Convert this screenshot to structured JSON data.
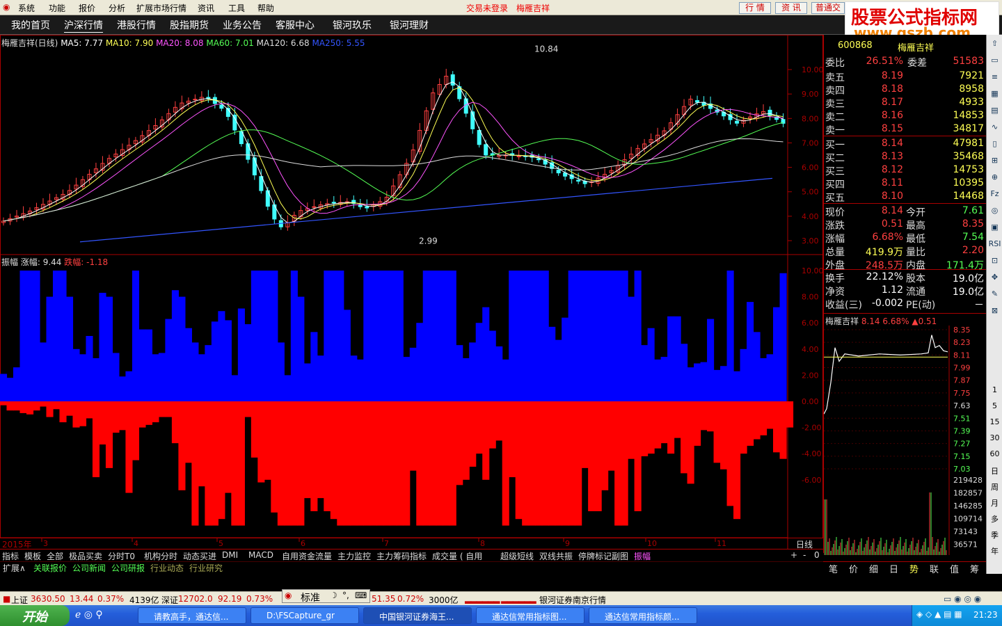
{
  "menu": [
    "系统",
    "功能",
    "报价",
    "分析",
    "扩展市场行情",
    "资讯",
    "工具",
    "帮助"
  ],
  "menu_status": {
    "login": "交易未登录",
    "stock": "梅雁吉祥"
  },
  "menu_buttons": [
    "行 情",
    "资 讯",
    "普通交易"
  ],
  "logo": {
    "line1": "股票公式指标网",
    "line2": "www.gszb.com"
  },
  "tabs": [
    "我的首页",
    "沪深行情",
    "港股行情",
    "股指期货",
    "业务公告",
    "客服中心",
    "银河玖乐",
    "银河理财"
  ],
  "main_title": "梅雁吉祥(日线)",
  "ma": [
    {
      "label": "MA5: 7.77",
      "color": "#ffffff"
    },
    {
      "label": "MA10: 7.90",
      "color": "#ffff55"
    },
    {
      "label": "MA20: 8.08",
      "color": "#ff55ff"
    },
    {
      "label": "MA60: 7.01",
      "color": "#55ff55"
    },
    {
      "label": "MA120: 6.68",
      "color": "#dddddd"
    },
    {
      "label": "MA250: 5.55",
      "color": "#3355ff"
    }
  ],
  "price_axis": [
    "10.00",
    "9.00",
    "8.00",
    "7.00",
    "6.00",
    "5.00",
    "4.00",
    "3.00"
  ],
  "high_label": "10.84",
  "low_label": "2.99",
  "ind_title": "振幅",
  "ind_up": "涨幅: 9.44",
  "ind_down": "跌幅: -1.18",
  "ind_axis": [
    "10.00",
    "8.00",
    "6.00",
    "4.00",
    "2.00",
    "0.00",
    "-2.00",
    "-4.00",
    "-6.00"
  ],
  "year_label": "2015年",
  "months": [
    "3",
    "4",
    "5",
    "6",
    "7",
    "8",
    "9",
    "10",
    "11"
  ],
  "period": "日线",
  "quote": {
    "code": "600868",
    "name": "梅雁吉祥",
    "wb": {
      "label": "委比",
      "value": "26.51%",
      "label2": "委差",
      "value2": "51583"
    },
    "sell": [
      {
        "label": "卖五",
        "price": "8.19",
        "vol": "7921"
      },
      {
        "label": "卖四",
        "price": "8.18",
        "vol": "8958"
      },
      {
        "label": "卖三",
        "price": "8.17",
        "vol": "4933"
      },
      {
        "label": "卖二",
        "price": "8.16",
        "vol": "14853"
      },
      {
        "label": "卖一",
        "price": "8.15",
        "vol": "34817"
      }
    ],
    "buy": [
      {
        "label": "买一",
        "price": "8.14",
        "vol": "47981"
      },
      {
        "label": "买二",
        "price": "8.13",
        "vol": "35468"
      },
      {
        "label": "买三",
        "price": "8.12",
        "vol": "14753"
      },
      {
        "label": "买四",
        "price": "8.11",
        "vol": "10395"
      },
      {
        "label": "买五",
        "price": "8.10",
        "vol": "14468"
      }
    ],
    "stats": [
      {
        "l1": "现价",
        "v1": "8.14",
        "l2": "今开",
        "v2": "7.61",
        "c1": "#ff4040",
        "c2": "#55ff55"
      },
      {
        "l1": "涨跌",
        "v1": "0.51",
        "l2": "最高",
        "v2": "8.35",
        "c1": "#ff4040",
        "c2": "#ff4040"
      },
      {
        "l1": "涨幅",
        "v1": "6.68%",
        "l2": "最低",
        "v2": "7.54",
        "c1": "#ff4040",
        "c2": "#55ff55"
      },
      {
        "l1": "总量",
        "v1": "419.9万",
        "l2": "量比",
        "v2": "2.20",
        "c1": "#ffff55",
        "c2": "#ff4040"
      },
      {
        "l1": "外盘",
        "v1": "248.5万",
        "l2": "内盘",
        "v2": "171.4万",
        "c1": "#ff4040",
        "c2": "#55ff55"
      },
      {
        "l1": "换手",
        "v1": "22.12%",
        "l2": "股本",
        "v2": "19.0亿",
        "c1": "#ffffff",
        "c2": "#ffffff"
      },
      {
        "l1": "净资",
        "v1": "1.12",
        "l2": "流通",
        "v2": "19.0亿",
        "c1": "#ffffff",
        "c2": "#ffffff"
      },
      {
        "l1": "收益(三)",
        "v1": "-0.002",
        "l2": "PE(动)",
        "v2": "－",
        "c1": "#ffffff",
        "c2": "#ffffff"
      }
    ]
  },
  "mini": {
    "name": "梅雁吉祥",
    "price": "8.14",
    "pct": "6.68%",
    "chg": "▲0.51",
    "axis": [
      "8.35",
      "8.23",
      "8.11",
      "7.99",
      "7.87",
      "7.75",
      "7.63",
      "7.51",
      "7.39",
      "7.27",
      "7.15",
      "7.03"
    ],
    "vol_axis": [
      "219428",
      "182857",
      "146285",
      "109714",
      "73143",
      "36571"
    ]
  },
  "ind_tabs": [
    "指标",
    "模板",
    "全部",
    "极品买卖",
    "分时T0",
    "机构分时",
    "动态买进",
    "DMI",
    "MACD",
    "自用资金流量",
    "主力监控",
    "主力筹码指标",
    "成交量 ( 自用",
    "超级短线",
    "双线共振",
    "停牌标记副图",
    "振幅"
  ],
  "ind_tab_ctrl": [
    "+",
    "-",
    "0"
  ],
  "ext_tabs": [
    "扩展∧",
    "关联报价",
    "公司新闻",
    "公司研报",
    "行业动态",
    "行业研究"
  ],
  "rtabs": [
    "笔",
    "价",
    "细",
    "日",
    "势",
    "联",
    "值",
    "筹"
  ],
  "side_tools": [
    "1",
    "5",
    "15",
    "30",
    "60",
    "日",
    "周",
    "月",
    "多",
    "季",
    "年"
  ],
  "status": {
    "sh_label": "上证",
    "sh_val": "3630.50",
    "sh_chg": "13.44",
    "sh_pct": "0.37%",
    "sh_amt": "4139亿",
    "sz_label": "深证",
    "sz_val": "12702.0",
    "sz_chg": "92.19",
    "sz_pct": "0.73%",
    "c_chg": "51.35",
    "c_pct": "0.72%",
    "c_amt": "3000亿",
    "broker": "银河证券南京行情"
  },
  "ime": "标准",
  "taskbar": {
    "start": "开始",
    "tasks": [
      "请教高手，通达信...",
      "D:\\FSCapture_gr",
      "中国银河证券海王...",
      "通达信常用指标图...",
      "通达信常用指标颜..."
    ],
    "time": "21:23"
  },
  "chart_data": {
    "type": "candlestick+bar",
    "title": "梅雁吉祥(日线)",
    "price_range": [
      2.8,
      11.0
    ],
    "amplitude_up": [
      2.1,
      1.8,
      2.6,
      10.0,
      10.0,
      10.0,
      4.5,
      8.0,
      10.0,
      10.0,
      8.0,
      4.0,
      3.6,
      5.0,
      3.3,
      8.3,
      8.0,
      3.7,
      1.9,
      2.3,
      10.0,
      5.5,
      5.5,
      3.6,
      3.7,
      6.3,
      8.5,
      8.0,
      5.6,
      4.5,
      3.6,
      4.3,
      6.1,
      6.9,
      6.2,
      2.0,
      7.1,
      5.9,
      10.0,
      10.0,
      10.0,
      10.0,
      4.5,
      2.0,
      10.0,
      8.0,
      2.9,
      5.3,
      3.5,
      10.0,
      10.0,
      10.0,
      7.0,
      3.5,
      3.2,
      10.0,
      10.0,
      10.0,
      10.0,
      10.0,
      10.0,
      3.4,
      4.1,
      6.0,
      10.0,
      10.0,
      10.0,
      10.0,
      10.0,
      4.3,
      3.3,
      4.5,
      6.0,
      7.2,
      5.4,
      4.2,
      3.2,
      10.0,
      10.0,
      10.0,
      10.0,
      10.0,
      10.0,
      5.7,
      4.7,
      6.4,
      10.0,
      10.0,
      10.0,
      10.0,
      10.0,
      10.0,
      10.0,
      10.0,
      10.0,
      8.0,
      10.0,
      4.3,
      5.6,
      3.2,
      3.4,
      6.5,
      6.5,
      4.4,
      2.6,
      2.9,
      3.0,
      6.3,
      2.4,
      2.7,
      10.0,
      2.3,
      4.0,
      7.6,
      5.3,
      3.3,
      3.6,
      7.2,
      9.8
    ],
    "amplitude_down": [
      -0.3,
      -0.7,
      -0.7,
      -0.9,
      -1.0,
      -0.7,
      -0.4,
      -1.2,
      -0.6,
      -1.6,
      -1.1,
      -2.0,
      -1.9,
      -1.3,
      -5.8,
      -3.3,
      -5.1,
      -2.4,
      -2.2,
      -7.0,
      -4.5,
      -2.0,
      -1.8,
      -1.6,
      -1.2,
      -1.2,
      -3.2,
      -6.8,
      -4.7,
      -9.5,
      -6.5,
      -9.5,
      -9.5,
      -9.0,
      -7.0,
      -9.5,
      -9.5,
      -1.2,
      -4.3,
      -6.2,
      -6.0,
      -8.5,
      -9.5,
      -9.5,
      -9.5,
      -9.5,
      -7.4,
      -8.4,
      -7.4,
      -8.4,
      -9.0,
      -9.5,
      -9.5,
      -9.5,
      -9.5,
      -9.5,
      -9.5,
      -9.5,
      -9.5,
      -9.5,
      -9.5,
      -9.5,
      -5.3,
      -9.5,
      -9.5,
      -9.5,
      -9.5,
      -9.5,
      -9.5,
      -6.4,
      -6.0,
      -5.0,
      -4.0,
      -6.0,
      -3.6,
      -3.0,
      -9.5,
      -5.8,
      -9.0,
      -9.5,
      -9.5,
      -9.5,
      -9.5,
      -9.5,
      -9.5,
      -9.5,
      -9.5,
      -9.5,
      -5.1,
      -8.4,
      -8.4,
      -6.8,
      -5.3,
      -9.5,
      -9.5,
      -4.4,
      -8.4,
      -4.2,
      -4.0,
      -3.6,
      -3.2,
      -4.0,
      -2.8,
      -5.5,
      -6.3,
      -3.4,
      -2.2,
      -2.3,
      -4.7,
      -5.2,
      -8.0,
      -9.0,
      -4.0,
      -3.4,
      -2.9,
      -2.6,
      -2.1,
      -3.9,
      -4.4,
      -2.0
    ],
    "ylim_amplitude": [
      -10,
      10
    ]
  }
}
